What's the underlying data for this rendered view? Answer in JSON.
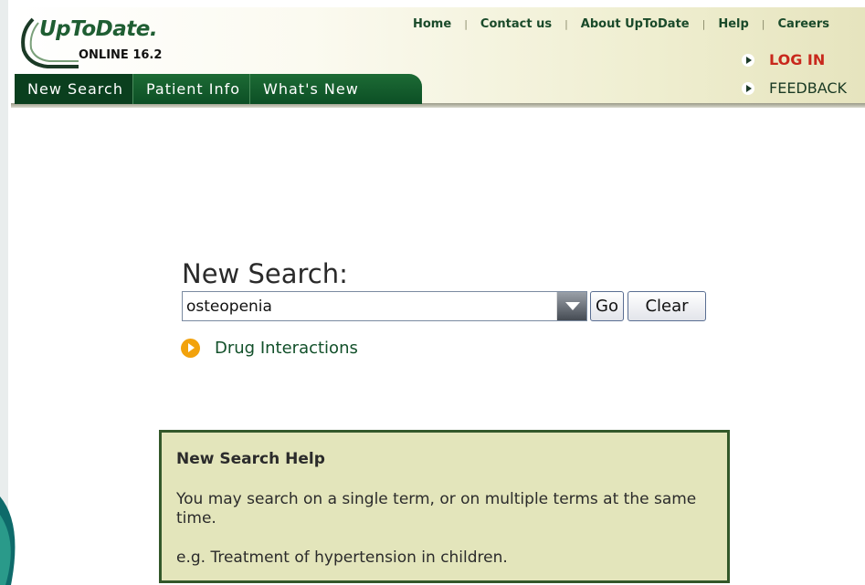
{
  "header": {
    "logo_title": "UpToDate.",
    "logo_subtitle": "ONLINE 16.2",
    "top_links": [
      "Home",
      "Contact us",
      "About UpToDate",
      "Help",
      "Careers"
    ],
    "login_label": "LOG IN",
    "feedback_label": "FEEDBACK"
  },
  "nav": {
    "tabs": [
      {
        "label": "New Search",
        "active": true
      },
      {
        "label": "Patient Info",
        "active": false
      },
      {
        "label": "What's New",
        "active": false
      }
    ]
  },
  "search": {
    "title": "New Search:",
    "input_value": "osteopenia",
    "go_label": "Go",
    "clear_label": "Clear",
    "drug_link": "Drug Interactions"
  },
  "help": {
    "title": "New Search Help",
    "text": "You may search on a single term, or on multiple terms at the same time.",
    "example": "e.g. Treatment of hypertension in children."
  },
  "colors": {
    "brand_green": "#1f5e33",
    "nav_green": "#0c4f25",
    "login_red": "#c8281c",
    "help_bg": "#e3e5bb",
    "drug_icon": "#f2a20c"
  },
  "icons": [
    "clock-logo-icon",
    "login-arrow-icon",
    "feedback-arrow-icon",
    "dropdown-arrow-icon",
    "drug-interactions-icon"
  ]
}
